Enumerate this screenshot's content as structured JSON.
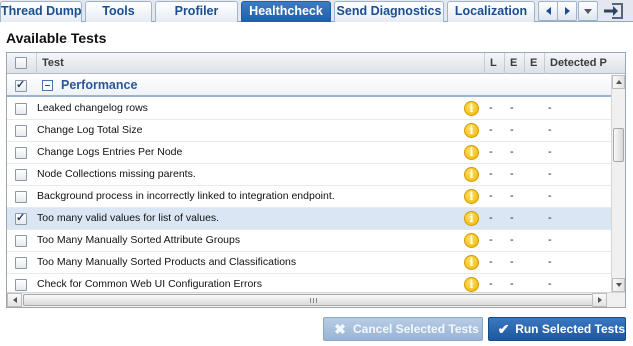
{
  "tabs": [
    {
      "label": "Thread Dump",
      "active": false
    },
    {
      "label": "Tools",
      "active": false
    },
    {
      "label": "Profiler",
      "active": false
    },
    {
      "label": "Healthcheck",
      "active": true
    },
    {
      "label": "Send Diagnostics",
      "active": false
    },
    {
      "label": "Localization",
      "active": false
    }
  ],
  "tab_controls": {
    "scroll_left_icon": "arrow-left-icon",
    "scroll_right_icon": "arrow-right-icon",
    "menu_icon": "chevron-down-icon",
    "exit_icon": "exit-icon"
  },
  "section_title": "Available Tests",
  "grid": {
    "columns": [
      "Test",
      "L",
      "E",
      "E",
      "Detected P"
    ],
    "group": {
      "label": "Performance",
      "checked": true,
      "expanded": true
    },
    "rows": [
      {
        "name": "Leaked changelog rows",
        "checked": false,
        "selected": false,
        "c1": "-",
        "c2": "-",
        "c3": "-"
      },
      {
        "name": "Change Log Total Size",
        "checked": false,
        "selected": false,
        "c1": "-",
        "c2": "-",
        "c3": "-"
      },
      {
        "name": "Change Logs Entries Per Node",
        "checked": false,
        "selected": false,
        "c1": "-",
        "c2": "-",
        "c3": "-"
      },
      {
        "name": "Node Collections missing parents.",
        "checked": false,
        "selected": false,
        "c1": "-",
        "c2": "-",
        "c3": "-"
      },
      {
        "name": "Background process in incorrectly linked to integration endpoint.",
        "checked": false,
        "selected": false,
        "c1": "-",
        "c2": "-",
        "c3": "-"
      },
      {
        "name": "Too many valid values for list of values.",
        "checked": true,
        "selected": true,
        "c1": "-",
        "c2": "-",
        "c3": "-"
      },
      {
        "name": "Too Many Manually Sorted Attribute Groups",
        "checked": false,
        "selected": false,
        "c1": "-",
        "c2": "-",
        "c3": "-"
      },
      {
        "name": "Too Many Manually Sorted Products and Classifications",
        "checked": false,
        "selected": false,
        "c1": "-",
        "c2": "-",
        "c3": "-"
      },
      {
        "name": "Check for Common Web UI Configuration Errors",
        "checked": false,
        "selected": false,
        "c1": "-",
        "c2": "-",
        "c3": "-"
      }
    ]
  },
  "buttons": {
    "cancel": "Cancel Selected Tests",
    "run": "Run Selected Tests"
  },
  "colors": {
    "accent": "#1f5ea8",
    "selected_row": "#dbe6f4",
    "info": "#f0b400"
  }
}
